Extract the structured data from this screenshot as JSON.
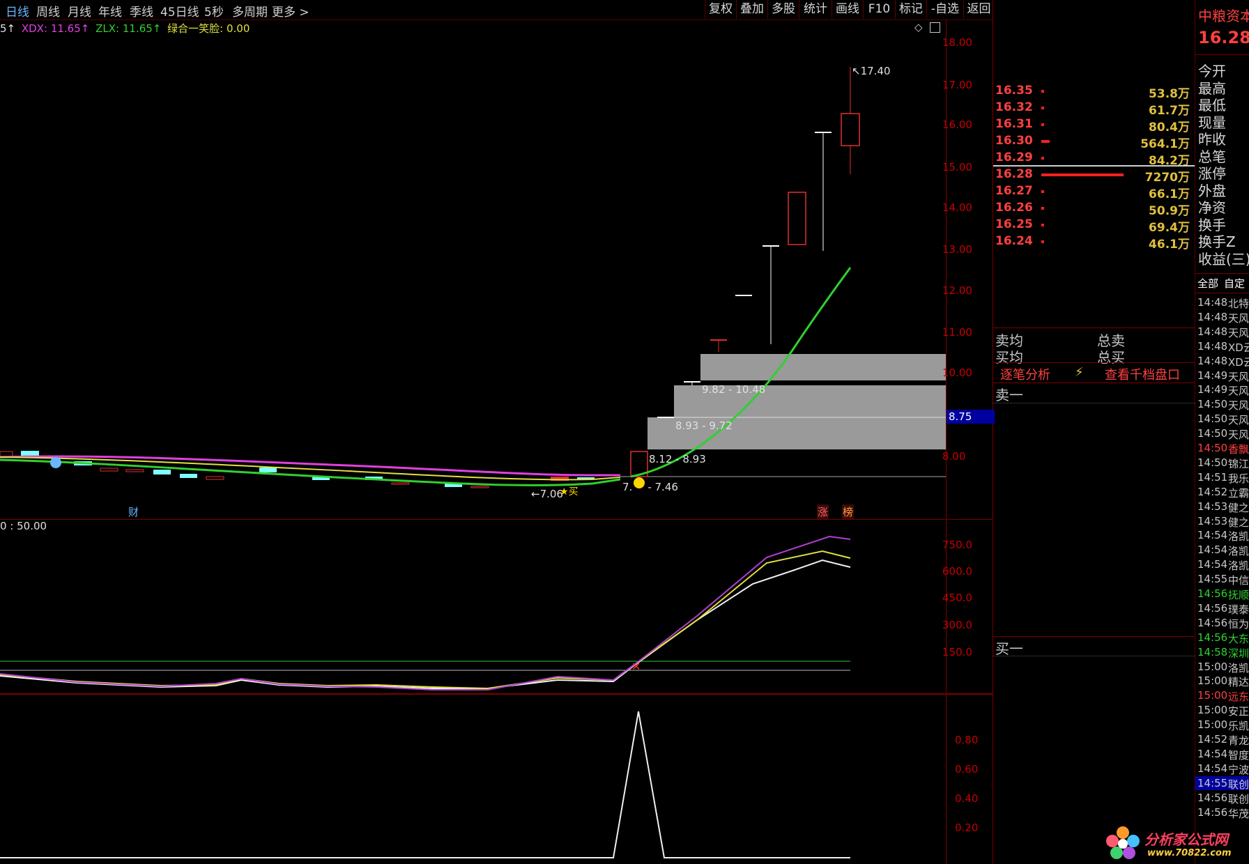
{
  "toolbar": {
    "periods": [
      "日线",
      "周线",
      "月线",
      "年线",
      "季线",
      "45日线",
      "5秒",
      "多周期",
      "更多 >"
    ],
    "buttons": [
      "复权",
      "叠加",
      "多股",
      "统计",
      "画线",
      "F10",
      "标记",
      "-自选",
      "返回"
    ]
  },
  "legend": {
    "prefix": "5↑",
    "xdx": "XDX: 11.65↑",
    "zlx": "ZLX: 11.65↑",
    "smile": "绿合一笑脸: 0.00"
  },
  "main_axis": [
    "18.00",
    "17.00",
    "16.00",
    "15.00",
    "14.00",
    "13.00",
    "12.00",
    "11.00",
    "10.00",
    "8.00"
  ],
  "current_price_tag": "8.75",
  "annotations": {
    "high": "17.40",
    "low": "7.06",
    "zone1": "9.82 - 10.48",
    "zone2": "8.93 - 9.72",
    "zone3": "8.12 - 8.93",
    "zone4": "7.46",
    "zone4_prefix": "7.",
    "buy_mark": "买",
    "cai": "财",
    "zhang": "涨",
    "bang": "榜"
  },
  "sub1": {
    "legend": "0 : 50.00",
    "axis": [
      "750.0",
      "600.0",
      "450.0",
      "300.0",
      "150.0"
    ]
  },
  "sub2": {
    "axis": [
      "0.80",
      "0.60",
      "0.40",
      "0.20"
    ]
  },
  "stock": {
    "name": "中粮资本",
    "price": "16.28"
  },
  "orderbook": [
    {
      "price": "16.35",
      "vol": "53.8万",
      "bar": 4
    },
    {
      "price": "16.32",
      "vol": "61.7万",
      "bar": 4
    },
    {
      "price": "16.31",
      "vol": "80.4万",
      "bar": 4
    },
    {
      "price": "16.30",
      "vol": "564.1万",
      "bar": 12
    },
    {
      "price": "16.29",
      "vol": "84.2万",
      "bar": 4
    },
    {
      "price": "16.28",
      "vol": "7270万",
      "bar": 118
    },
    {
      "price": "16.27",
      "vol": "66.1万",
      "bar": 4
    },
    {
      "price": "16.26",
      "vol": "50.9万",
      "bar": 4
    },
    {
      "price": "16.25",
      "vol": "69.4万",
      "bar": 4
    },
    {
      "price": "16.24",
      "vol": "46.1万",
      "bar": 4
    }
  ],
  "quote_labels": [
    "今开",
    "最高",
    "最低",
    "现量",
    "昨收",
    "总笔",
    "涨停",
    "外盘",
    "净资",
    "换手",
    "换手Z",
    "收益(三)"
  ],
  "summary": {
    "sell_avg": "卖均",
    "total_sell": "总卖",
    "buy_avg": "买均",
    "total_buy": "总买",
    "tick_analysis": "逐笔分析",
    "view_levels": "查看千档盘口",
    "sell1": "卖一",
    "buy1": "买一"
  },
  "ticker_tabs": [
    "全部",
    "自定"
  ],
  "ticker": [
    {
      "t": "14:48",
      "n": "北特",
      "c": "#c8c8c8"
    },
    {
      "t": "14:48",
      "n": "天风",
      "c": "#c8c8c8"
    },
    {
      "t": "14:48",
      "n": "天风",
      "c": "#c8c8c8"
    },
    {
      "t": "14:48",
      "n": "XD云",
      "c": "#c8c8c8"
    },
    {
      "t": "14:48",
      "n": "XD云",
      "c": "#c8c8c8"
    },
    {
      "t": "14:49",
      "n": "天风",
      "c": "#c8c8c8"
    },
    {
      "t": "14:49",
      "n": "天风",
      "c": "#c8c8c8"
    },
    {
      "t": "14:50",
      "n": "天风",
      "c": "#c8c8c8"
    },
    {
      "t": "14:50",
      "n": "天风",
      "c": "#c8c8c8"
    },
    {
      "t": "14:50",
      "n": "天风",
      "c": "#c8c8c8"
    },
    {
      "t": "14:50",
      "n": "香飘",
      "c": "#ff4040"
    },
    {
      "t": "14:50",
      "n": "锦江",
      "c": "#c8c8c8"
    },
    {
      "t": "14:51",
      "n": "我乐",
      "c": "#c8c8c8"
    },
    {
      "t": "14:52",
      "n": "立霸",
      "c": "#c8c8c8"
    },
    {
      "t": "14:53",
      "n": "健之",
      "c": "#c8c8c8"
    },
    {
      "t": "14:53",
      "n": "健之",
      "c": "#c8c8c8"
    },
    {
      "t": "14:54",
      "n": "洛凯",
      "c": "#c8c8c8"
    },
    {
      "t": "14:54",
      "n": "洛凯",
      "c": "#c8c8c8"
    },
    {
      "t": "14:54",
      "n": "洛凯",
      "c": "#c8c8c8"
    },
    {
      "t": "14:55",
      "n": "中信",
      "c": "#c8c8c8"
    },
    {
      "t": "14:56",
      "n": "抚顺",
      "c": "#30d030"
    },
    {
      "t": "14:56",
      "n": "璞泰",
      "c": "#c8c8c8"
    },
    {
      "t": "14:56",
      "n": "恒为",
      "c": "#c8c8c8"
    },
    {
      "t": "14:56",
      "n": "大东",
      "c": "#30d030"
    },
    {
      "t": "14:58",
      "n": "深圳",
      "c": "#30d030"
    },
    {
      "t": "15:00",
      "n": "洛凯",
      "c": "#c8c8c8"
    },
    {
      "t": "15:00",
      "n": "精达",
      "c": "#c8c8c8"
    },
    {
      "t": "15:00",
      "n": "远东",
      "c": "#ff4040"
    },
    {
      "t": "15:00",
      "n": "安正",
      "c": "#c8c8c8"
    },
    {
      "t": "15:00",
      "n": "乐凯",
      "c": "#c8c8c8"
    },
    {
      "t": "14:52",
      "n": "青龙",
      "c": "#c8c8c8"
    },
    {
      "t": "14:54",
      "n": "智度",
      "c": "#c8c8c8"
    },
    {
      "t": "14:54",
      "n": "宁波",
      "c": "#c8c8c8"
    },
    {
      "t": "14:55",
      "n": "联创",
      "c": "#c8c8c8"
    },
    {
      "t": "14:56",
      "n": "联创",
      "c": "#c8c8c8"
    },
    {
      "t": "14:56",
      "n": "华茂",
      "c": "#c8c8c8"
    }
  ],
  "watermark": {
    "title": "分析家公式网",
    "url": "www.70822.com"
  }
}
